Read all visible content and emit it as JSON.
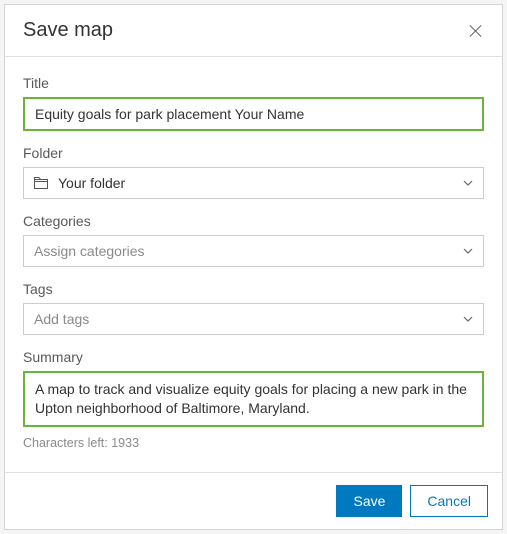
{
  "header": {
    "title": "Save map"
  },
  "fields": {
    "title": {
      "label": "Title",
      "value": "Equity goals for park placement Your Name"
    },
    "folder": {
      "label": "Folder",
      "value": "Your folder"
    },
    "categories": {
      "label": "Categories",
      "placeholder": "Assign categories"
    },
    "tags": {
      "label": "Tags",
      "placeholder": "Add tags"
    },
    "summary": {
      "label": "Summary",
      "value": "A map to track and visualize equity goals for placing a new park in the Upton neighborhood of Baltimore, Maryland.",
      "hint": "Characters left: 1933"
    }
  },
  "footer": {
    "save": "Save",
    "cancel": "Cancel"
  }
}
